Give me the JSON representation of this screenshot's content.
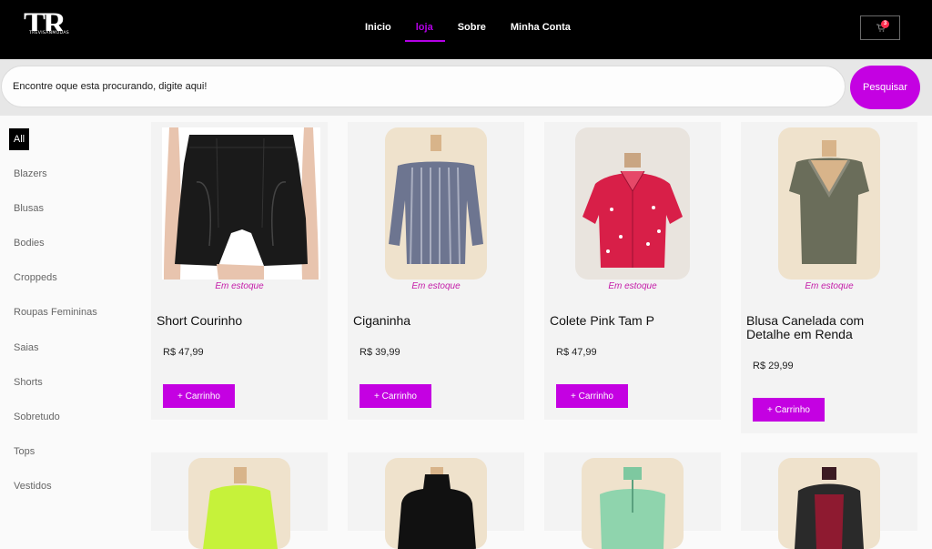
{
  "brand": {
    "monogram": "TR",
    "tagline": "TREVISANMODAS"
  },
  "nav": {
    "items": [
      "Inicio",
      "loja",
      "Sobre",
      "Minha Conta"
    ],
    "active": "loja"
  },
  "cart": {
    "count": "3",
    "icon": "cart-icon"
  },
  "search": {
    "placeholder": "Encontre oque esta procurando, digite aqui!",
    "button_label": "Pesquisar"
  },
  "categories": {
    "all_label": "All",
    "items": [
      "Blazers",
      "Blusas",
      "Bodies",
      "Croppeds",
      "Roupas Femininas",
      "Saias",
      "Shorts",
      "Sobretudo",
      "Tops",
      "Vestidos"
    ]
  },
  "products": [
    {
      "stock": "Em estoque",
      "name": "Short Courinho",
      "price": "R$ 47,99",
      "button": "+ Carrinho"
    },
    {
      "stock": "Em estoque",
      "name": "Ciganinha",
      "price": "R$ 39,99",
      "button": "+ Carrinho"
    },
    {
      "stock": "Em estoque",
      "name": "Colete Pink Tam P",
      "price": "R$ 47,99",
      "button": "+ Carrinho"
    },
    {
      "stock": "Em estoque",
      "name": "Blusa Canelada com Detalhe em Renda",
      "price": "R$ 29,99",
      "button": "+ Carrinho"
    }
  ],
  "colors": {
    "accent": "#c401e2",
    "stock_text": "#c41ca8",
    "header_bg": "#000000",
    "badge": "#ff2e4f"
  }
}
